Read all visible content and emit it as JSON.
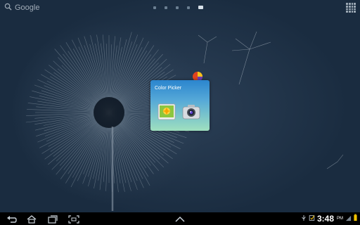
{
  "search": {
    "label": "Google"
  },
  "home": {
    "page_count": 5,
    "active_page": 5
  },
  "folder": {
    "title": "Color Picker",
    "apps": [
      {
        "icon": "gallery-icon"
      },
      {
        "icon": "camera-icon"
      }
    ]
  },
  "status": {
    "time": "3:48",
    "ampm": "PM",
    "icons": [
      "usb-icon",
      "notification-icon",
      "signal-icon",
      "battery-icon"
    ]
  },
  "navigation": {
    "buttons": [
      "back-icon",
      "home-icon",
      "recent-apps-icon",
      "screenshot-icon",
      "menu-up-icon"
    ]
  }
}
